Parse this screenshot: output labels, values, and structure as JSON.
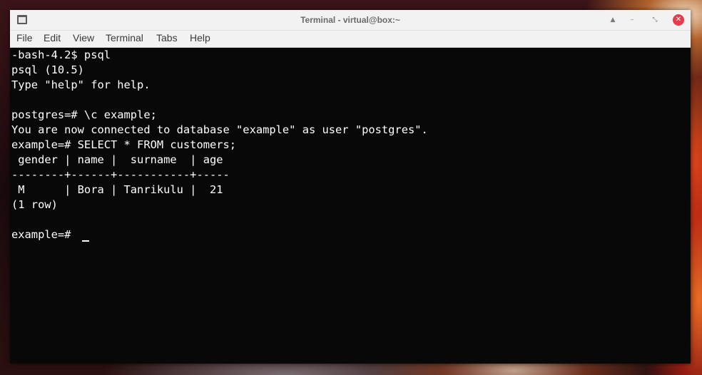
{
  "window": {
    "title": "Terminal - virtual@box:~"
  },
  "titlebar_buttons": {
    "shade": "▲",
    "minimize": "–",
    "maximize": "⤡",
    "close": "✕"
  },
  "menu": {
    "items": [
      "File",
      "Edit",
      "View",
      "Terminal",
      "Tabs",
      "Help"
    ]
  },
  "terminal": {
    "lines": [
      "-bash-4.2$ psql",
      "psql (10.5)",
      "Type \"help\" for help.",
      "",
      "postgres=# \\c example;",
      "You are now connected to database \"example\" as user \"postgres\".",
      "example=# SELECT * FROM customers;",
      " gender | name |  surname  | age",
      "--------+------+-----------+-----",
      " M      | Bora | Tanrikulu |  21",
      "(1 row)",
      "",
      "example=# "
    ]
  },
  "icons": {
    "app": "terminal-app-icon",
    "cursor": "block-cursor"
  }
}
